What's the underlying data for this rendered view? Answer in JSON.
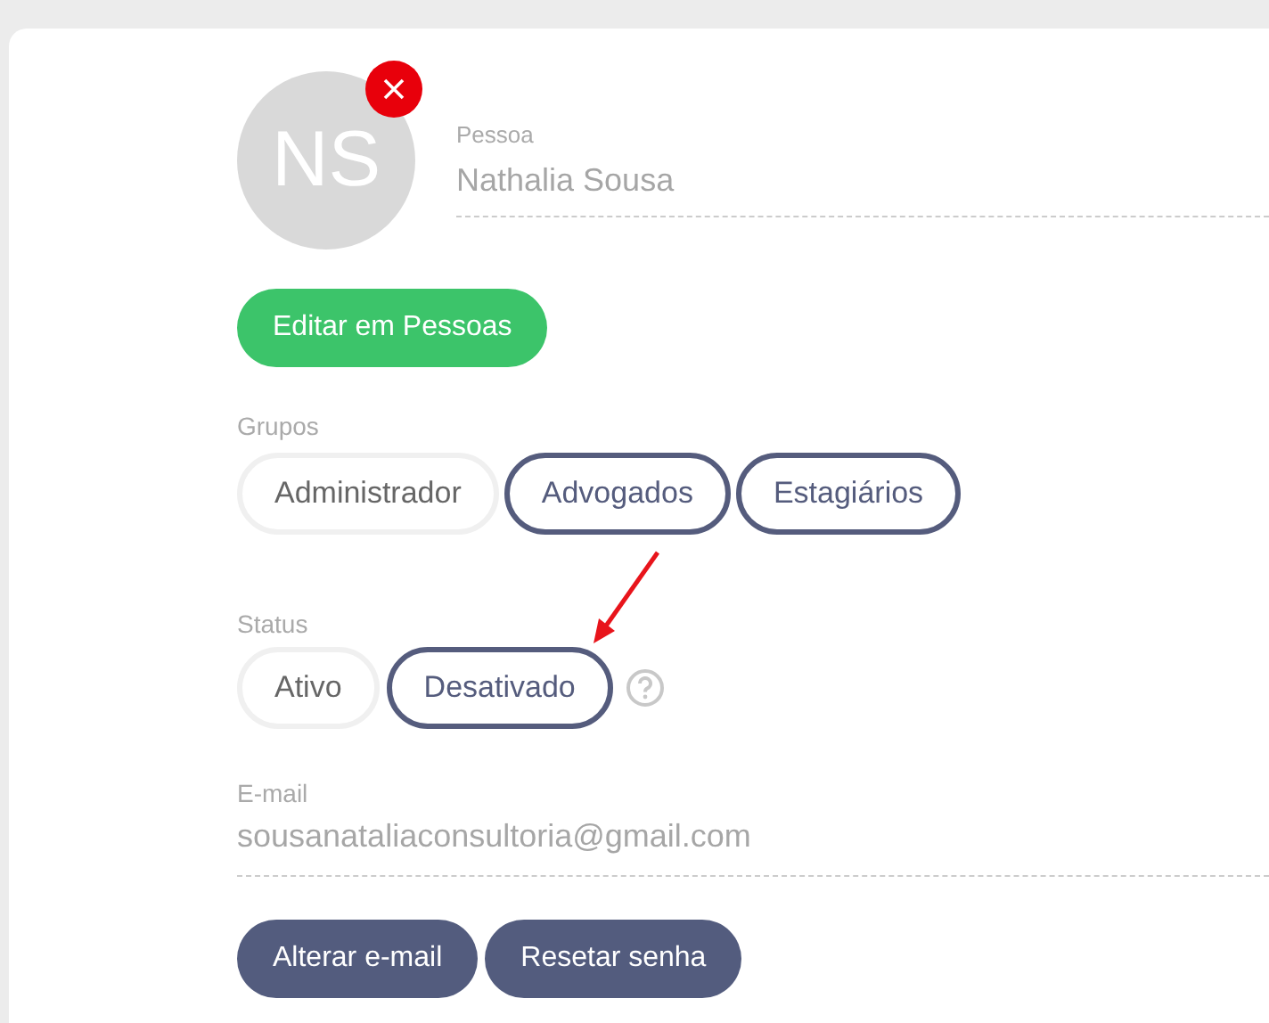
{
  "person": {
    "initials": "NS",
    "label": "Pessoa",
    "value": "Nathalia Sousa"
  },
  "edit_button": "Editar em Pessoas",
  "groups": {
    "label": "Grupos",
    "options": [
      {
        "label": "Administrador",
        "selected": false
      },
      {
        "label": "Advogados",
        "selected": true
      },
      {
        "label": "Estagiários",
        "selected": true
      }
    ]
  },
  "status": {
    "label": "Status",
    "options": [
      {
        "label": "Ativo",
        "selected": false
      },
      {
        "label": "Desativado",
        "selected": true
      }
    ]
  },
  "email": {
    "label": "E-mail",
    "value": "sousanataliaconsultoria@gmail.com"
  },
  "buttons": [
    "Alterar e-mail",
    "Resetar senha"
  ]
}
